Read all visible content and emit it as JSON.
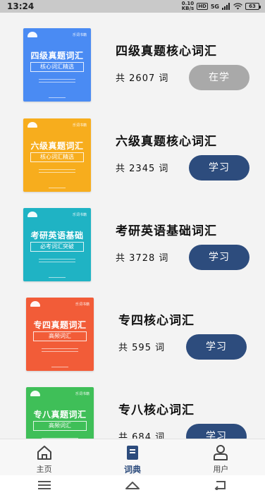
{
  "status": {
    "time": "13:24",
    "speed_value": "0.10",
    "speed_unit": "KB/s",
    "hd": "HD",
    "network": "5G",
    "battery": "63"
  },
  "books": [
    {
      "title": "四级真题核心词汇",
      "count_prefix": "共",
      "count": "2607",
      "count_suffix": "词",
      "button": "在学",
      "cover_title": "四级真题词汇",
      "cover_sub": "核心词汇精选",
      "cover_brand": "乐词书籍",
      "cover_color": "#4a8bf3",
      "state": "studying"
    },
    {
      "title": "六级真题核心词汇",
      "count_prefix": "共",
      "count": "2345",
      "count_suffix": "词",
      "button": "学习",
      "cover_title": "六级真题词汇",
      "cover_sub": "核心词汇精选",
      "cover_brand": "乐词书籍",
      "cover_color": "#f7ad1d",
      "state": "learn"
    },
    {
      "title": "考研英语基础词汇",
      "count_prefix": "共",
      "count": "3728",
      "count_suffix": "词",
      "button": "学习",
      "cover_title": "考研英语基础",
      "cover_sub": "必考词汇突破",
      "cover_brand": "乐词书籍",
      "cover_color": "#1fb3c4",
      "state": "learn"
    },
    {
      "title": "专四核心词汇",
      "count_prefix": "共",
      "count": "595",
      "count_suffix": "词",
      "button": "学习",
      "cover_title": "专四真题词汇",
      "cover_sub": "高频词汇",
      "cover_brand": "乐词书籍",
      "cover_color": "#f25c38",
      "state": "learn"
    },
    {
      "title": "专八核心词汇",
      "count_prefix": "共",
      "count": "684",
      "count_suffix": "词",
      "button": "学习",
      "cover_title": "专八真题词汇",
      "cover_sub": "高频词汇",
      "cover_brand": "乐词书籍",
      "cover_color": "#3fbf58",
      "state": "learn"
    }
  ],
  "tabs": [
    {
      "label": "主页",
      "icon": "home-icon",
      "active": false
    },
    {
      "label": "词典",
      "icon": "dictionary-icon",
      "active": true
    },
    {
      "label": "用户",
      "icon": "user-icon",
      "active": false
    }
  ],
  "colors": {
    "accent": "#2d4c7d",
    "studying_button": "#a9a9a9",
    "background": "#f3f3f3"
  },
  "system_nav": [
    "menu-icon",
    "home-triangle-icon",
    "back-icon"
  ]
}
